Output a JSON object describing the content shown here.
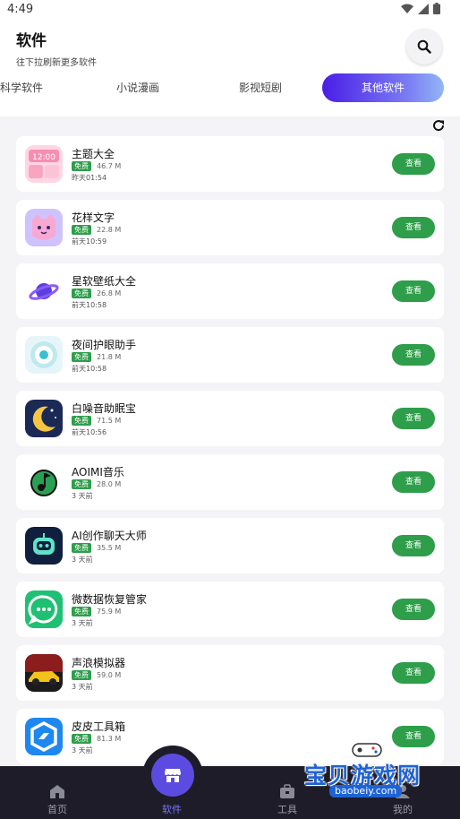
{
  "status_bar": {
    "time": "4:49"
  },
  "header": {
    "title": "软件",
    "subtitle": "往下拉刷新更多软件",
    "search_icon": "search-icon"
  },
  "tabs": [
    {
      "label": "科学软件",
      "active": false
    },
    {
      "label": "小说漫画",
      "active": false
    },
    {
      "label": "影视短剧",
      "active": false
    },
    {
      "label": "其他软件",
      "active": true
    }
  ],
  "list": {
    "free_label": "免费",
    "view_label": "查看",
    "apps": [
      {
        "name": "主题大全",
        "size": "46.7 M",
        "time": "昨天01:54",
        "icon": "clock-theme-icon"
      },
      {
        "name": "花样文字",
        "size": "22.8 M",
        "time": "前天10:59",
        "icon": "cat-face-icon"
      },
      {
        "name": "星软壁纸大全",
        "size": "26.8 M",
        "time": "前天10:58",
        "icon": "planet-icon"
      },
      {
        "name": "夜间护眼助手",
        "size": "21.8 M",
        "time": "前天10:58",
        "icon": "eye-icon"
      },
      {
        "name": "白噪音助眠宝",
        "size": "71.5 M",
        "time": "前天10:56",
        "icon": "moon-icon"
      },
      {
        "name": "AOIMI音乐",
        "size": "28.0 M",
        "time": "3 天前",
        "icon": "music-note-icon"
      },
      {
        "name": "AI创作聊天大师",
        "size": "35.5 M",
        "time": "3 天前",
        "icon": "robot-icon"
      },
      {
        "name": "微数据恢复管家",
        "size": "75.9 M",
        "time": "3 天前",
        "icon": "chat-bubble-icon"
      },
      {
        "name": "声浪模拟器",
        "size": "59.0 M",
        "time": "3 天前",
        "icon": "sports-car-icon"
      },
      {
        "name": "皮皮工具箱",
        "size": "81.3 M",
        "time": "3 天前",
        "icon": "toolbox-icon"
      }
    ]
  },
  "bottom_nav": [
    {
      "label": "首页",
      "icon": "home-icon",
      "active": false
    },
    {
      "label": "软件",
      "icon": "store-icon",
      "active": true
    },
    {
      "label": "工具",
      "icon": "toolbag-icon",
      "active": false
    },
    {
      "label": "我的",
      "icon": "user-icon",
      "active": false
    }
  ],
  "watermark": {
    "text": "宝贝游戏网",
    "url": "baobeiy.com"
  },
  "colors": {
    "accent": "#5b4be0",
    "green": "#2e9e4a",
    "nav_bg": "#1e1c28"
  }
}
